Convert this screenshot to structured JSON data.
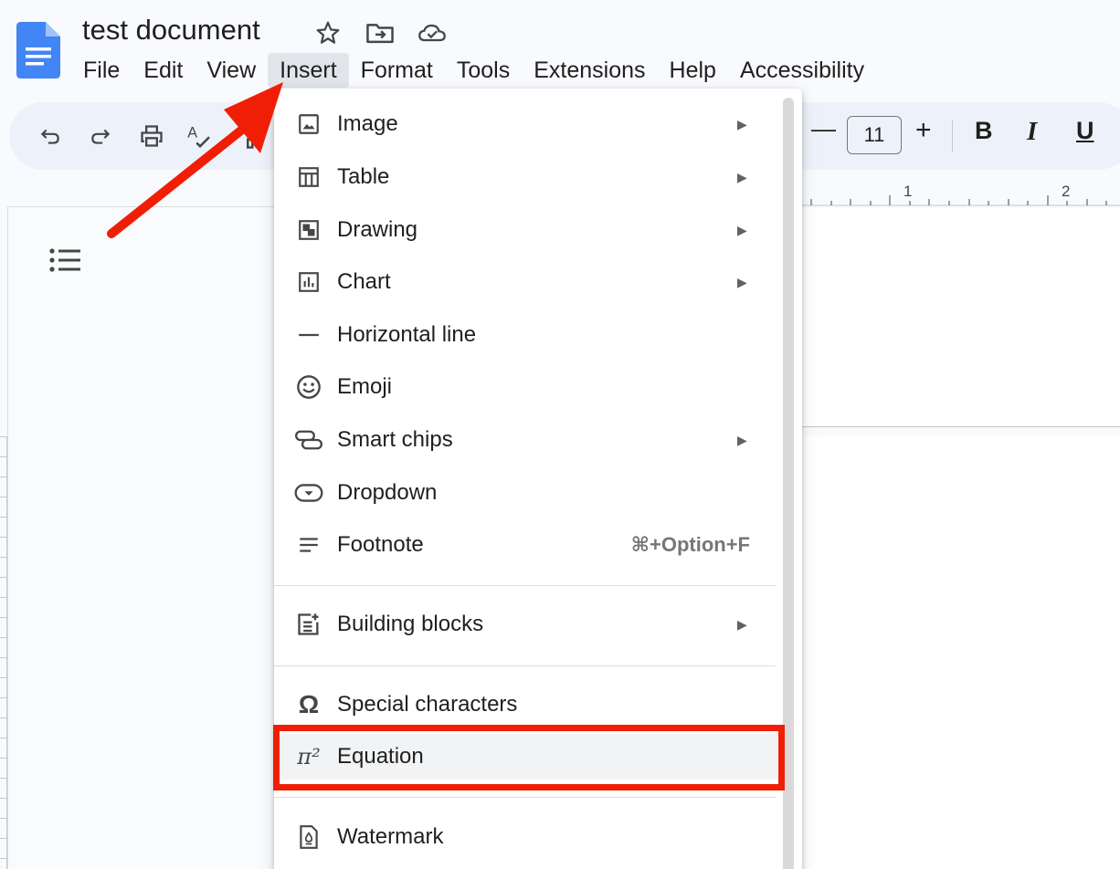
{
  "document": {
    "title": "test document"
  },
  "menubar": {
    "items": [
      "File",
      "Edit",
      "View",
      "Insert",
      "Format",
      "Tools",
      "Extensions",
      "Help",
      "Accessibility"
    ],
    "active": "Insert"
  },
  "toolbar": {
    "font_size": "11",
    "bold_label": "B",
    "italic_label": "I",
    "underline_label": "U",
    "minus_label": "—",
    "plus_label": "+"
  },
  "ruler": {
    "marks": [
      "1",
      "2"
    ]
  },
  "insert_menu": {
    "items": [
      {
        "label": "Image",
        "icon": "image-icon",
        "submenu": true
      },
      {
        "label": "Table",
        "icon": "table-icon",
        "submenu": true
      },
      {
        "label": "Drawing",
        "icon": "drawing-icon",
        "submenu": true
      },
      {
        "label": "Chart",
        "icon": "chart-icon",
        "submenu": true
      },
      {
        "label": "Horizontal line",
        "icon": "horizontal-line-icon",
        "submenu": false
      },
      {
        "label": "Emoji",
        "icon": "emoji-icon",
        "submenu": false
      },
      {
        "label": "Smart chips",
        "icon": "smart-chips-icon",
        "submenu": true
      },
      {
        "label": "Dropdown",
        "icon": "dropdown-icon",
        "submenu": false
      },
      {
        "label": "Footnote",
        "icon": "footnote-icon",
        "submenu": false,
        "shortcut": "⌘+Option+F"
      },
      {
        "label": "Building blocks",
        "icon": "building-blocks-icon",
        "submenu": true
      },
      {
        "label": "Special characters",
        "icon": "omega-icon",
        "submenu": false
      },
      {
        "label": "Equation",
        "icon": "pi-squared-icon",
        "submenu": false,
        "highlighted": true
      },
      {
        "label": "Watermark",
        "icon": "watermark-icon",
        "submenu": false
      }
    ],
    "equation_icon_text": "π²",
    "special_icon_text": "Ω",
    "submenu_arrow": "▶"
  },
  "colors": {
    "annotation_red": "#f11e06",
    "docs_blue": "#4285f4",
    "menu_active_bg": "#e1e5ea",
    "toolbar_bg": "#edf2fa"
  }
}
